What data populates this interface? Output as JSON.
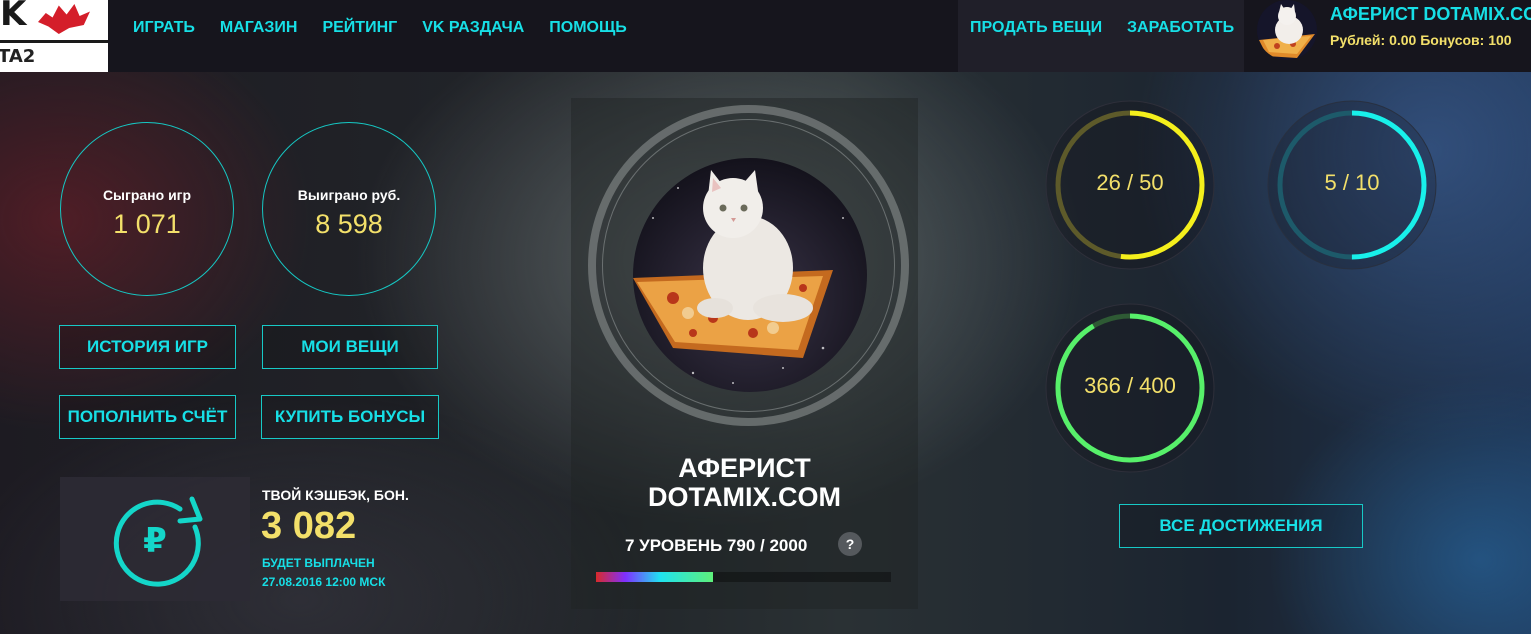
{
  "logo": {
    "mark": "K",
    "text": "TA2"
  },
  "nav": [
    {
      "label": "ИГРАТЬ"
    },
    {
      "label": "МАГАЗИН"
    },
    {
      "label": "РЕЙТИНГ"
    },
    {
      "label": "VK РАЗДАЧА"
    },
    {
      "label": "ПОМОЩЬ"
    }
  ],
  "nav_right": [
    {
      "label": "ПРОДАТЬ ВЕЩИ"
    },
    {
      "label": "ЗАРАБОТАТЬ"
    }
  ],
  "user": {
    "name": "АФЕРИСТ DOTAMIX.COM",
    "balance": "Рублей: 0.00 Бонусов: 100"
  },
  "stats": [
    {
      "label": "Сыграно игр",
      "value": "1 071"
    },
    {
      "label": "Выиграно руб.",
      "value": "8 598"
    }
  ],
  "buttons": {
    "history": "ИСТОРИЯ ИГР",
    "my_items": "МОИ ВЕЩИ",
    "top_up": "ПОПОЛНИТЬ СЧЁТ",
    "buy_bonus": "КУПИТЬ БОНУСЫ",
    "all_achievements": "ВСЕ ДОСТИЖЕНИЯ"
  },
  "cashback": {
    "title": "ТВОЙ КЭШБЭК, БОН.",
    "value": "3 082",
    "note_line1": "БУДЕТ ВЫПЛАЧЕН",
    "note_line2": "27.08.2016 12:00 МСК",
    "icon": "ruble-refresh-icon"
  },
  "profile": {
    "name_line1": "АФЕРИСТ",
    "name_line2": "DOTAMIX.COM",
    "level_text": "7 УРОВЕНЬ 790 / 2000",
    "help": "?",
    "xp_progress": 0.395
  },
  "achievements": [
    {
      "text": "26 / 50",
      "progress": 0.52,
      "color": "#f4ef1c",
      "track": "#5d5a2a"
    },
    {
      "text": "5 / 10",
      "progress": 0.5,
      "color": "#18f0ea",
      "track": "#1d5a6a"
    },
    {
      "text": "366 / 400",
      "progress": 0.915,
      "color": "#57f06a",
      "track": "#2e5a34"
    }
  ],
  "colors": {
    "accent": "#17dfe6",
    "gold": "#f3e06a"
  }
}
